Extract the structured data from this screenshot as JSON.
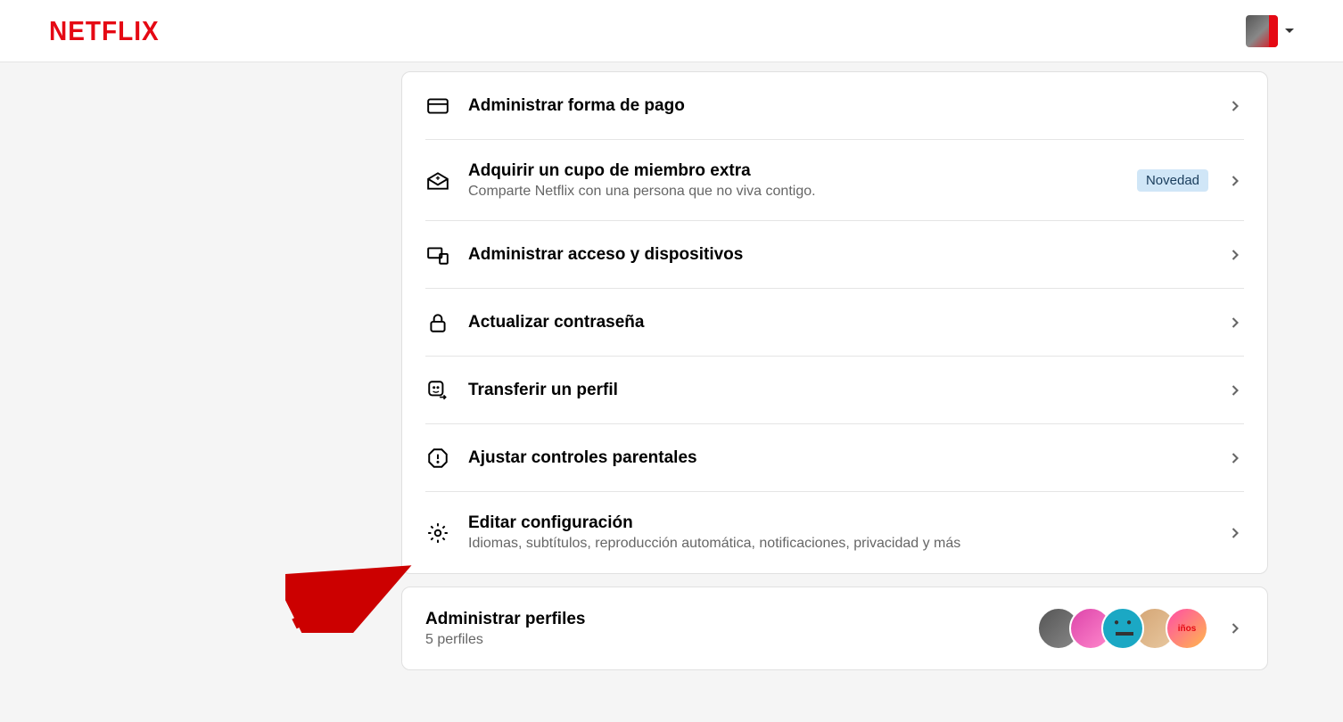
{
  "header": {
    "logo": "NETFLIX"
  },
  "settings": {
    "items": [
      {
        "title": "Administrar forma de pago",
        "subtitle": "",
        "badge": ""
      },
      {
        "title": "Adquirir un cupo de miembro extra",
        "subtitle": "Comparte Netflix con una persona que no viva contigo.",
        "badge": "Novedad"
      },
      {
        "title": "Administrar acceso y dispositivos",
        "subtitle": "",
        "badge": ""
      },
      {
        "title": "Actualizar contraseña",
        "subtitle": "",
        "badge": ""
      },
      {
        "title": "Transferir un perfil",
        "subtitle": "",
        "badge": ""
      },
      {
        "title": "Ajustar controles parentales",
        "subtitle": "",
        "badge": ""
      },
      {
        "title": "Editar configuración",
        "subtitle": "Idiomas, subtítulos, reproducción automática, notificaciones, privacidad y más",
        "badge": ""
      }
    ]
  },
  "profiles": {
    "title": "Administrar perfiles",
    "subtitle": "5 perfiles",
    "kids_label": "iños"
  }
}
